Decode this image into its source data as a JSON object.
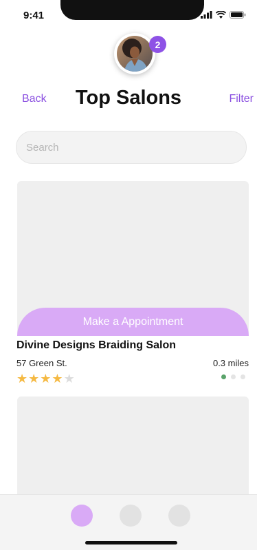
{
  "status_bar": {
    "time": "9:41"
  },
  "profile": {
    "badge_count": "2",
    "avatar_icon": "user-photo"
  },
  "header": {
    "back_label": "Back",
    "title": "Top Salons",
    "filter_label": "Filter"
  },
  "search": {
    "placeholder": "Search"
  },
  "salons": [
    {
      "name": "Divine Designs Braiding Salon",
      "address": "57 Green St.",
      "distance": "0.3 miles",
      "rating": 4,
      "max_rating": 5,
      "cta_label": "Make a Appointment",
      "carousel_pages": 3,
      "carousel_active": 0
    }
  ],
  "colors": {
    "accent": "#8a4fe0",
    "accent_light": "#d9aaf6",
    "star": "#f5b942",
    "star_empty": "#dcdcdc",
    "carousel_active": "#5aa36a"
  },
  "tab_bar": {
    "tab_count": 3,
    "active_index": 0
  }
}
